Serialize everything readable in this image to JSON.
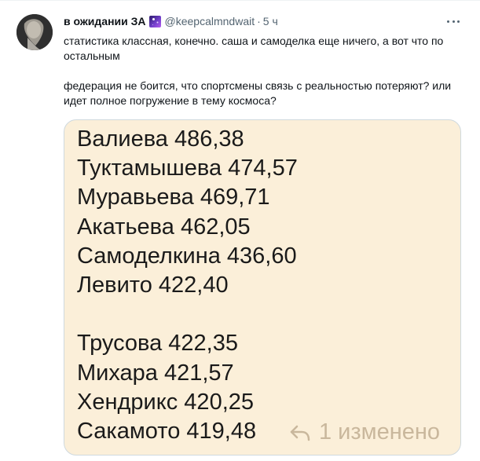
{
  "tweet": {
    "display_name": "в ожидании ЗА",
    "badge_icon": "galaxy-emoji-icon",
    "handle": "@keepcalmndwait",
    "separator": "·",
    "time": "5 ч",
    "more_icon": "more-dots-icon",
    "text_paragraph1": "статистика классная, конечно. саша и самоделка еще ничего, а вот что по остальным",
    "text_paragraph2": "федерация не боится, что спортсмены связь с реальностью потеряют? или идет полное погружение в тему космоса?"
  },
  "image": {
    "background": "#fbefd9",
    "lines": [
      "Валиева 486,38",
      "Туктамышева 474,57",
      "Муравьева 469,71",
      "Акатьева 462,05",
      "Самоделкина 436,60",
      "Левито 422,40",
      "",
      "Трусова 422,35",
      "Михара 421,57",
      "Хендрикс 420,25",
      "Сакамото 419,48"
    ],
    "edited_icon": "reply-arrow-icon",
    "edited_label": "1 изменено"
  }
}
